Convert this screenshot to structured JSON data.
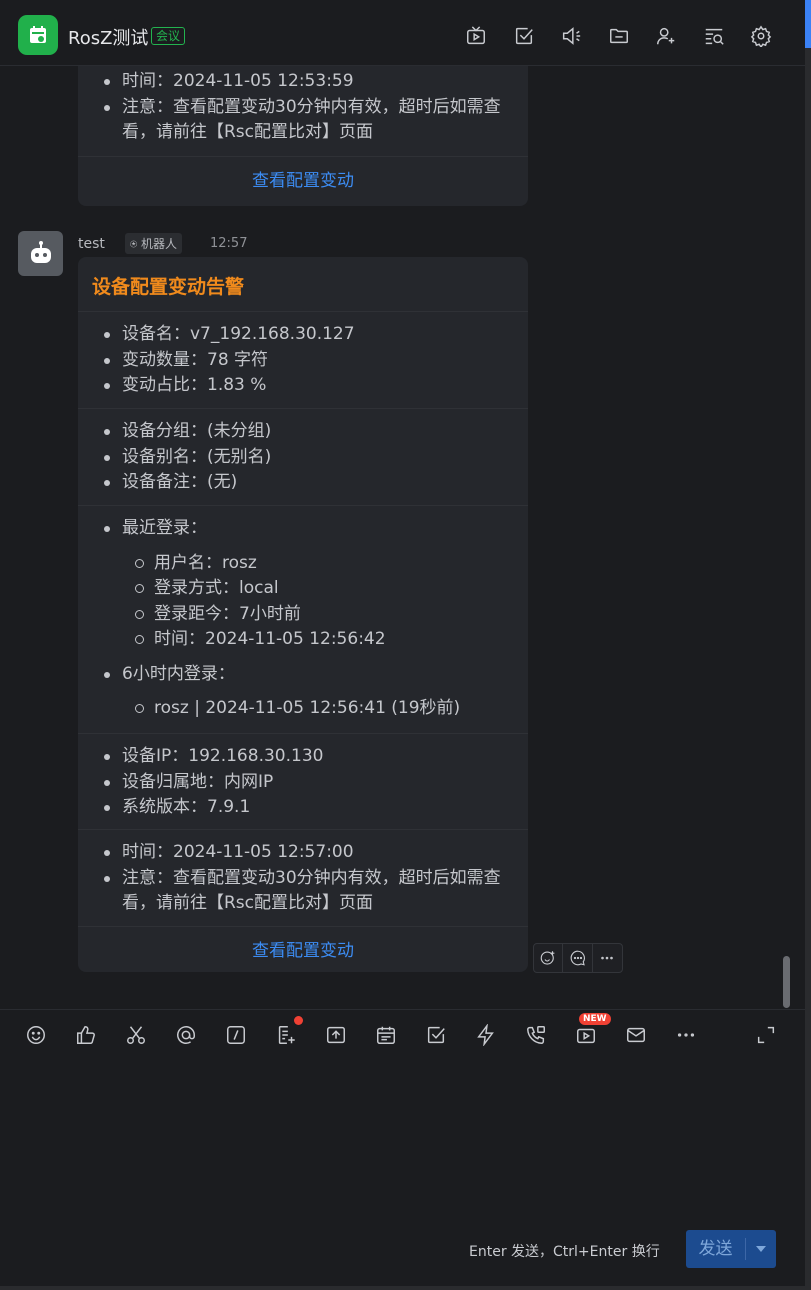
{
  "header": {
    "title": "RosZ测试",
    "badge": "会议",
    "icons": [
      "live-icon",
      "task-icon",
      "announce-icon",
      "folder-icon",
      "add-member-icon",
      "search-history-icon",
      "settings-icon"
    ]
  },
  "prev_card": {
    "items": [
      "时间：2024-11-05 12:53:59",
      "注意：查看配置变动30分钟内有效，超时后如需查看，请前往【Rsc配置比对】页面"
    ],
    "link": "查看配置变动"
  },
  "message": {
    "sender": "test",
    "bot_tag": "机器人",
    "time": "12:57",
    "title": "设备配置变动告警",
    "sec1": [
      "设备名：v7_192.168.30.127",
      "变动数量：78 字符",
      "变动占比：1.83 %"
    ],
    "sec2": [
      "设备分组：(未分组)",
      "设备别名：(无别名)",
      "设备备注：(无)"
    ],
    "sec3": {
      "recent_login": "最近登录：",
      "recent_items": [
        "用户名：rosz",
        "登录方式：local",
        "登录距今：7小时前",
        "时间：2024-11-05 12:56:42"
      ],
      "six_hour": "6小时内登录：",
      "six_hour_items": [
        "rosz | 2024-11-05 12:56:41 (19秒前)"
      ]
    },
    "sec4": [
      "设备IP：192.168.30.130",
      "设备归属地：内网IP",
      "系统版本：7.9.1"
    ],
    "sec5": [
      "时间：2024-11-05 12:57:00",
      "注意：查看配置变动30分钟内有效，超时后如需查看，请前往【Rsc配置比对】页面"
    ],
    "link": "查看配置变动"
  },
  "toolbar": {
    "new_tag": "NEW"
  },
  "composer": {
    "hint": "Enter 发送，Ctrl+Enter 换行",
    "send_label": "发送"
  }
}
